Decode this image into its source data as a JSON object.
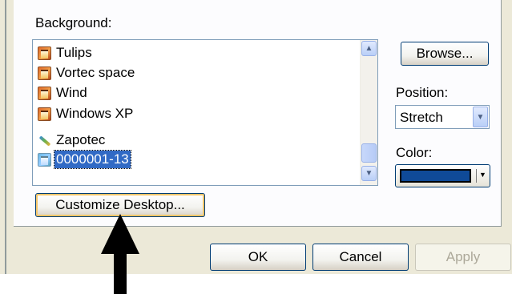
{
  "background": {
    "label": "Background:",
    "items": [
      {
        "label": "Tulips",
        "icon": "image-file-icon"
      },
      {
        "label": "Vortec space",
        "icon": "image-file-icon"
      },
      {
        "label": "Wind",
        "icon": "image-file-icon"
      },
      {
        "label": "Windows XP",
        "icon": "image-file-icon"
      },
      {
        "label": "Zapotec",
        "icon": "paint-file-icon"
      },
      {
        "label": "0000001-13",
        "icon": "image-file-icon",
        "selected": true
      }
    ]
  },
  "browse_label": "Browse...",
  "position": {
    "label": "Position:",
    "value": "Stretch"
  },
  "color": {
    "label": "Color:",
    "value": "#0f4a98"
  },
  "customize_label": "Customize Desktop...",
  "footer": {
    "ok_label": "OK",
    "cancel_label": "Cancel",
    "apply_label": "Apply"
  },
  "colors": {
    "dialog_bg": "#ece9d8",
    "selection": "#316ac5",
    "annotation_arrow": "#000000"
  }
}
